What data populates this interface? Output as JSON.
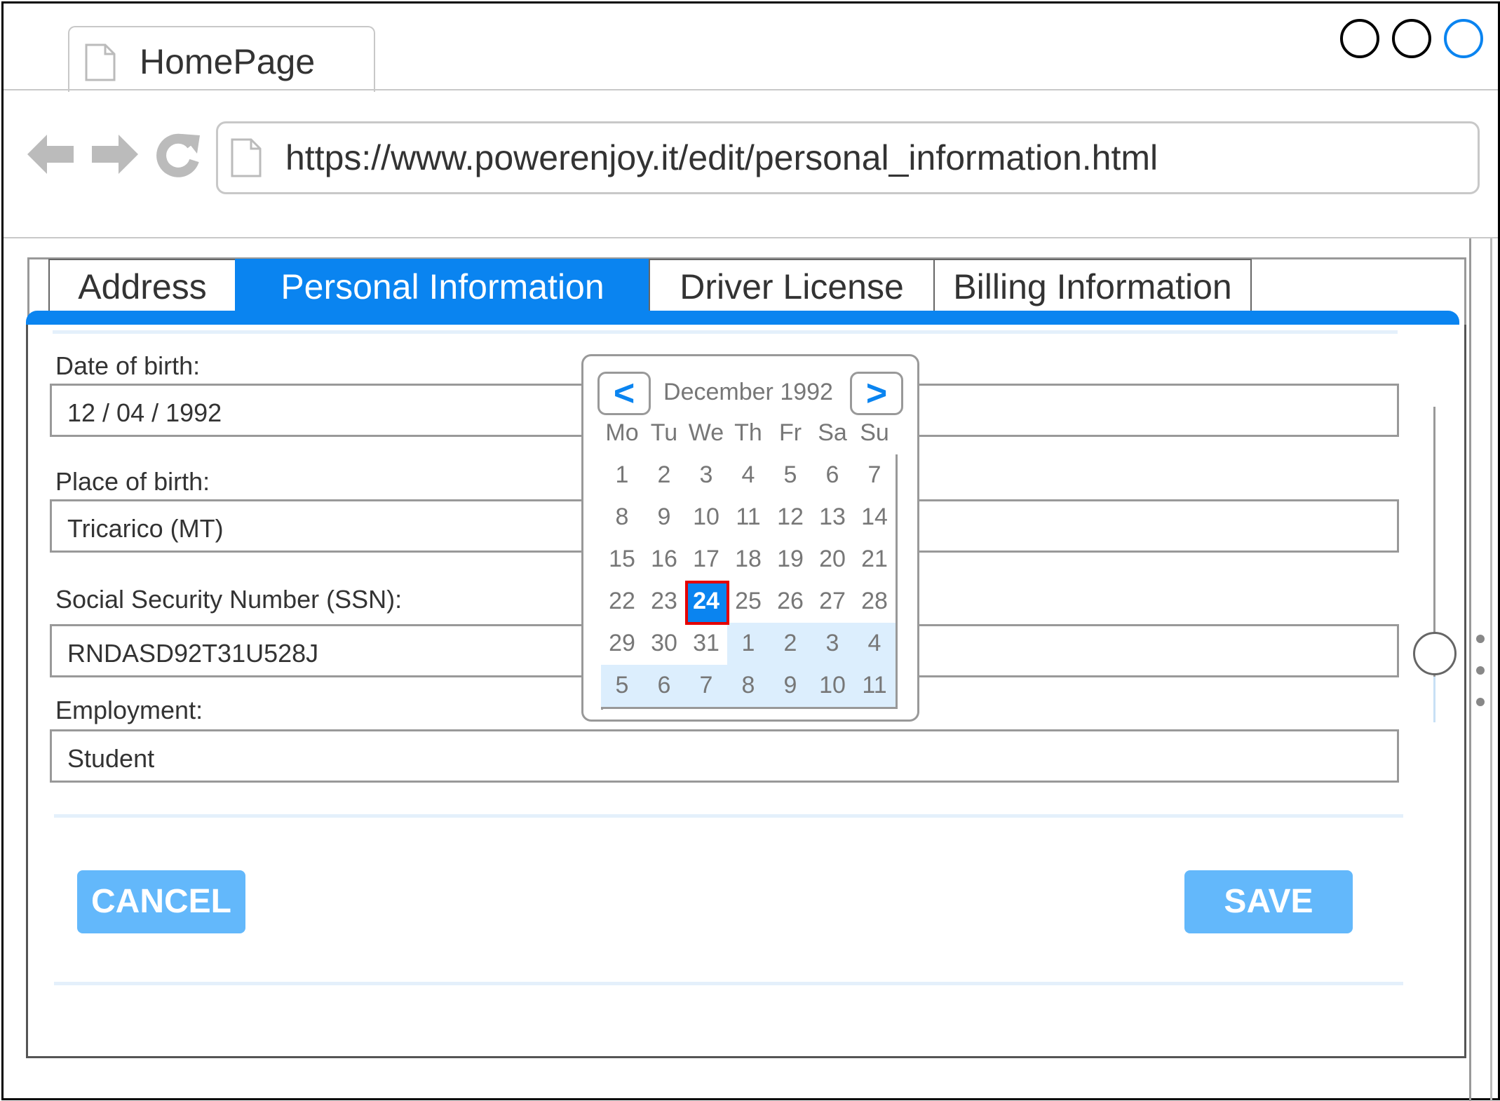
{
  "browser": {
    "tab_title": "HomePage",
    "url": "https://www.powerenjoy.it/edit/personal_information.html"
  },
  "tabs": [
    {
      "label": "Address",
      "active": false
    },
    {
      "label": "Personal Information",
      "active": true
    },
    {
      "label": "Driver License",
      "active": false
    },
    {
      "label": "Billing Information",
      "active": false
    }
  ],
  "form": {
    "dob": {
      "label": "Date of birth:",
      "value": "12 / 04 / 1992"
    },
    "pob": {
      "label": "Place of birth:",
      "value": "Tricarico (MT)"
    },
    "ssn": {
      "label": "Social Security Number (SSN):",
      "value": "RNDASD92T31U528J"
    },
    "employment": {
      "label": "Employment:",
      "value": "Student"
    }
  },
  "buttons": {
    "cancel": "CANCEL",
    "save": "SAVE"
  },
  "calendar": {
    "title": "December 1992",
    "prev": "<",
    "next": ">",
    "weekdays": [
      "Mo",
      "Tu",
      "We",
      "Th",
      "Fr",
      "Sa",
      "Su"
    ],
    "weeks": [
      [
        "1",
        "2",
        "3",
        "4",
        "5",
        "6",
        "7"
      ],
      [
        "8",
        "9",
        "10",
        "11",
        "12",
        "13",
        "14"
      ],
      [
        "15",
        "16",
        "17",
        "18",
        "19",
        "20",
        "21"
      ],
      [
        "22",
        "23",
        "24",
        "25",
        "26",
        "27",
        "28"
      ],
      [
        "29",
        "30",
        "31",
        "1",
        "2",
        "3",
        "4"
      ],
      [
        "5",
        "6",
        "7",
        "8",
        "9",
        "10",
        "11"
      ]
    ],
    "selected": "24",
    "current_month_last_day_index": 30
  },
  "colors": {
    "accent": "#0a84f0",
    "button": "#63b8fb",
    "selected_outline": "#e60000",
    "other_month": "#dceefd"
  }
}
